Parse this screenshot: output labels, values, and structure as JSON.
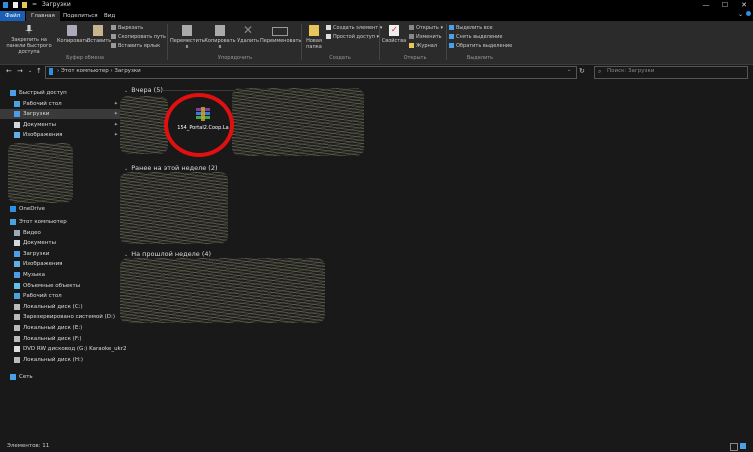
{
  "window": {
    "title": "Загрузки",
    "controls": {
      "minimize": "—",
      "maximize": "☐",
      "close": "✕"
    }
  },
  "tabs": [
    {
      "label": "Файл"
    },
    {
      "label": "Главная"
    },
    {
      "label": "Поделиться"
    },
    {
      "label": "Вид"
    }
  ],
  "ribbon": {
    "clipboard": {
      "pin_label": "Закрепить на панели быстрого доступа",
      "copy_label": "Копировать",
      "paste_label": "Вставить",
      "cut_label": "Вырезать",
      "copy_path_label": "Скопировать путь",
      "paste_shortcut_label": "Вставить ярлык",
      "group_label": "Буфер обмена"
    },
    "organize": {
      "move_label": "Переместить в",
      "copy_to_label": "Копировать в",
      "delete_label": "Удалить",
      "rename_label": "Переименовать",
      "group_label": "Упорядочить"
    },
    "new": {
      "new_folder_label": "Новая папка",
      "new_item_label": "Создать элемент",
      "easy_access_label": "Простой доступ",
      "group_label": "Создать"
    },
    "open": {
      "properties_label": "Свойства",
      "open_label": "Открыть",
      "edit_label": "Изменить",
      "history_label": "Журнал",
      "group_label": "Открыть"
    },
    "select": {
      "select_all_label": "Выделить все",
      "select_none_label": "Снять выделение",
      "invert_label": "Обратить выделение",
      "group_label": "Выделить"
    }
  },
  "address": {
    "crumbs": [
      "Этот компьютер",
      "Загрузки"
    ],
    "search_placeholder": "Поиск: Загрузки"
  },
  "sidebar": {
    "quick_access": [
      {
        "label": "Быстрый доступ",
        "icon": "star-icon",
        "color": "#4a9fe8"
      },
      {
        "label": "Рабочий стол",
        "icon": "desktop-icon",
        "color": "#4aa3df",
        "pinned": true
      },
      {
        "label": "Загрузки",
        "icon": "download-icon",
        "color": "#4a9fe8",
        "pinned": true,
        "selected": true
      },
      {
        "label": "Документы",
        "icon": "documents-icon",
        "color": "#cfd8e0",
        "pinned": true
      },
      {
        "label": "Изображения",
        "icon": "pictures-icon",
        "color": "#5fb0e8",
        "pinned": true
      }
    ],
    "onedrive": {
      "label": "OneDrive",
      "icon": "cloud-icon",
      "color": "#2f8fe0"
    },
    "this_pc": [
      {
        "label": "Этот компьютер",
        "icon": "computer-icon",
        "color": "#4aa3df"
      },
      {
        "label": "Видео",
        "icon": "video-icon",
        "color": "#9ab"
      },
      {
        "label": "Документы",
        "icon": "documents-icon",
        "color": "#cfd8e0"
      },
      {
        "label": "Загрузки",
        "icon": "download-icon",
        "color": "#4a9fe8"
      },
      {
        "label": "Изображения",
        "icon": "pictures-icon",
        "color": "#5fb0e8"
      },
      {
        "label": "Музыка",
        "icon": "music-icon",
        "color": "#4a9fe8"
      },
      {
        "label": "Объемные объекты",
        "icon": "3d-objects-icon",
        "color": "#5fc0e8"
      },
      {
        "label": "Рабочий стол",
        "icon": "desktop-icon",
        "color": "#4aa3df"
      },
      {
        "label": "Локальный диск (C:)",
        "icon": "drive-icon",
        "color": "#bbb"
      },
      {
        "label": "Зарезервировано системой (D:)",
        "icon": "drive-icon",
        "color": "#bbb"
      },
      {
        "label": "Локальный диск (E:)",
        "icon": "drive-icon",
        "color": "#bbb"
      },
      {
        "label": "Локальный диск (F:)",
        "icon": "drive-icon",
        "color": "#bbb"
      },
      {
        "label": "DVD RW дисковод (G:) Karaoke_ukr2",
        "icon": "dvd-icon",
        "color": "#ddd"
      },
      {
        "label": "Локальный диск (H:)",
        "icon": "drive-icon",
        "color": "#bbb"
      }
    ],
    "network": {
      "label": "Сеть",
      "icon": "network-icon",
      "color": "#4a9fe8"
    }
  },
  "main": {
    "groups": [
      {
        "label": "Вчера (5)"
      },
      {
        "label": "Ранее на этой неделе (2)"
      },
      {
        "label": "На прошлой неделе (4)"
      }
    ],
    "file": {
      "name": "154_Portal2.Coop.La",
      "icon": "winrar-archive-icon"
    }
  },
  "status": {
    "text": "Элементов: 11"
  },
  "accent": "#1a5fb4",
  "highlight_circle_color": "#e01010"
}
